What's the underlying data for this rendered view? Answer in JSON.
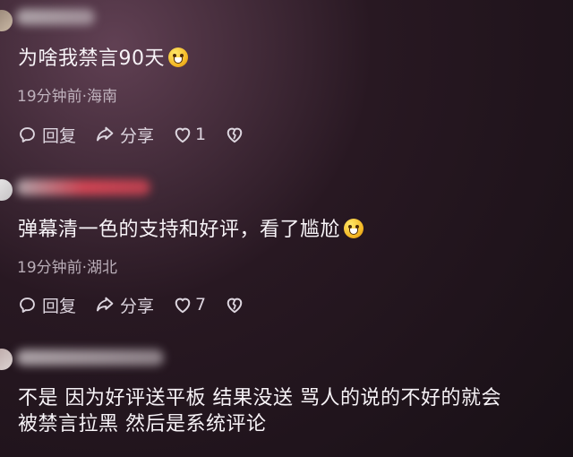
{
  "comments": [
    {
      "text": "为啥我禁言90天",
      "meta": "19分钟前·海南",
      "reply": "回复",
      "share": "分享",
      "likes": "1",
      "icons": [
        "comment-bubble-icon",
        "share-icon",
        "heart-icon",
        "broken-heart-icon",
        "grinning-sweat-emoji"
      ]
    },
    {
      "text": "弹幕清一色的支持和好评，看了尴尬",
      "meta": "19分钟前·湖北",
      "reply": "回复",
      "share": "分享",
      "likes": "7",
      "icons": [
        "comment-bubble-icon",
        "share-icon",
        "heart-icon",
        "broken-heart-icon",
        "grinning-sweat-emoji"
      ]
    },
    {
      "text_line_1": "不是  因为好评送平板  结果没送  骂人的说的不好的就会",
      "text_line_2": "被禁言拉黑  然后是系统评论"
    }
  ]
}
